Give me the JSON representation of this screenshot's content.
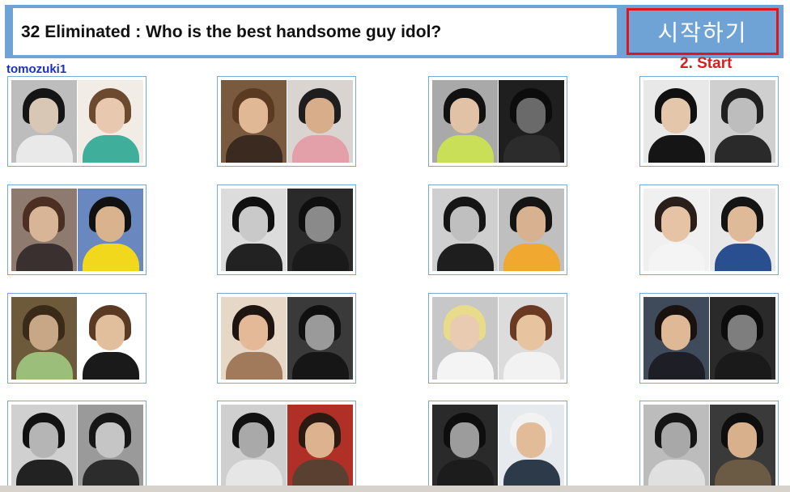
{
  "header": {
    "title": "32 Eliminated : Who is the best handsome guy idol?",
    "start_label": "시작하기",
    "step_note": "2. Start"
  },
  "username": "tomozuki1",
  "colors": {
    "accent_blue": "#6fa3d6",
    "highlight_red": "#e0161d",
    "username_blue": "#1a2fc4"
  },
  "cards": [
    {
      "photos": [
        {
          "bg": "#bdbdbd",
          "hair": "#151515",
          "face": "#d9c7b6",
          "body": "#e9e9e9"
        },
        {
          "bg": "#f2ece6",
          "hair": "#6b4a2f",
          "face": "#e8c9b0",
          "body": "#3fae9a"
        }
      ]
    },
    {
      "photos": [
        {
          "bg": "#7a5a3f",
          "hair": "#5a3a20",
          "face": "#e0b896",
          "body": "#3b2a20"
        },
        {
          "bg": "#d9d4cf",
          "hair": "#1e1e1e",
          "face": "#d8ad8a",
          "body": "#e3a0a8"
        }
      ]
    },
    {
      "photos": [
        {
          "bg": "#a9a9a9",
          "hair": "#111111",
          "face": "#e2c2a6",
          "body": "#c9df57"
        },
        {
          "bg": "#1f1f1f",
          "hair": "#0c0c0c",
          "face": "#6a6a6a",
          "body": "#2c2c2c"
        }
      ]
    },
    {
      "photos": [
        {
          "bg": "#e8e8e8",
          "hair": "#101010",
          "face": "#e4c6aa",
          "body": "#151515"
        },
        {
          "bg": "#cfcfcf",
          "hair": "#202020",
          "face": "#bdbdbd",
          "body": "#2a2a2a"
        }
      ]
    },
    {
      "photos": [
        {
          "bg": "#8f7a70",
          "hair": "#4a2f22",
          "face": "#d8b596",
          "body": "#3a3030"
        },
        {
          "bg": "#6a88c0",
          "hair": "#111111",
          "face": "#d9b28e",
          "body": "#f2d81c"
        }
      ]
    },
    {
      "photos": [
        {
          "bg": "#dcdcdc",
          "hair": "#101010",
          "face": "#c9c9c9",
          "body": "#222222"
        },
        {
          "bg": "#2a2a2a",
          "hair": "#0f0f0f",
          "face": "#8a8a8a",
          "body": "#1a1a1a"
        }
      ]
    },
    {
      "photos": [
        {
          "bg": "#cfcfcf",
          "hair": "#151515",
          "face": "#bfbfbf",
          "body": "#1e1e1e"
        },
        {
          "bg": "#bfbfbf",
          "hair": "#141414",
          "face": "#d8b290",
          "body": "#f0a830"
        }
      ]
    },
    {
      "photos": [
        {
          "bg": "#f0f0f0",
          "hair": "#2a1f1a",
          "face": "#e6c3a4",
          "body": "#f4f4f4"
        },
        {
          "bg": "#e8e8e8",
          "hair": "#141414",
          "face": "#dfba98",
          "body": "#2a4f90"
        }
      ]
    },
    {
      "photos": [
        {
          "bg": "#6d5a3a",
          "hair": "#3a2a18",
          "face": "#c8a786",
          "body": "#9bbf7a"
        },
        {
          "bg": "#ffffff",
          "hair": "#5a3a22",
          "face": "#e2bf9c",
          "body": "#1a1a1a"
        }
      ]
    },
    {
      "photos": [
        {
          "bg": "#e7d7c6",
          "hair": "#1e1410",
          "face": "#e3b998",
          "body": "#a07a5a"
        },
        {
          "bg": "#3a3a3a",
          "hair": "#101010",
          "face": "#9a9a9a",
          "body": "#161616"
        }
      ]
    },
    {
      "photos": [
        {
          "bg": "#c7c7c7",
          "hair": "#e8dc8a",
          "face": "#e8cbb0",
          "body": "#f4f4f4"
        },
        {
          "bg": "#dcdcdc",
          "hair": "#6a3a22",
          "face": "#e7c3a0",
          "body": "#f2f2f2"
        }
      ]
    },
    {
      "photos": [
        {
          "bg": "#3f4a5a",
          "hair": "#1a120e",
          "face": "#dfb896",
          "body": "#1e1e26"
        },
        {
          "bg": "#2a2a2a",
          "hair": "#0c0c0c",
          "face": "#7e7e7e",
          "body": "#1a1a1a"
        }
      ]
    },
    {
      "photos": [
        {
          "bg": "#d0d0d0",
          "hair": "#121212",
          "face": "#b5b5b5",
          "body": "#222222"
        },
        {
          "bg": "#9a9a9a",
          "hair": "#161616",
          "face": "#c5c5c5",
          "body": "#2c2c2c"
        }
      ]
    },
    {
      "photos": [
        {
          "bg": "#cfcfcf",
          "hair": "#111111",
          "face": "#a9a9a9",
          "body": "#e6e6e6"
        },
        {
          "bg": "#b03028",
          "hair": "#2a1a12",
          "face": "#dcb28f",
          "body": "#5a4030"
        }
      ]
    },
    {
      "photos": [
        {
          "bg": "#2a2a2a",
          "hair": "#0e0e0e",
          "face": "#9c9c9c",
          "body": "#1c1c1c"
        },
        {
          "bg": "#e6e9ee",
          "hair": "#f2f2f2",
          "face": "#e2bc98",
          "body": "#2c3a4a"
        }
      ]
    },
    {
      "photos": [
        {
          "bg": "#bcbcbc",
          "hair": "#151515",
          "face": "#a8a8a8",
          "body": "#e0e0e0"
        },
        {
          "bg": "#3a3a3a",
          "hair": "#0e0e0e",
          "face": "#d9b08c",
          "body": "#6b5a44"
        }
      ]
    }
  ]
}
